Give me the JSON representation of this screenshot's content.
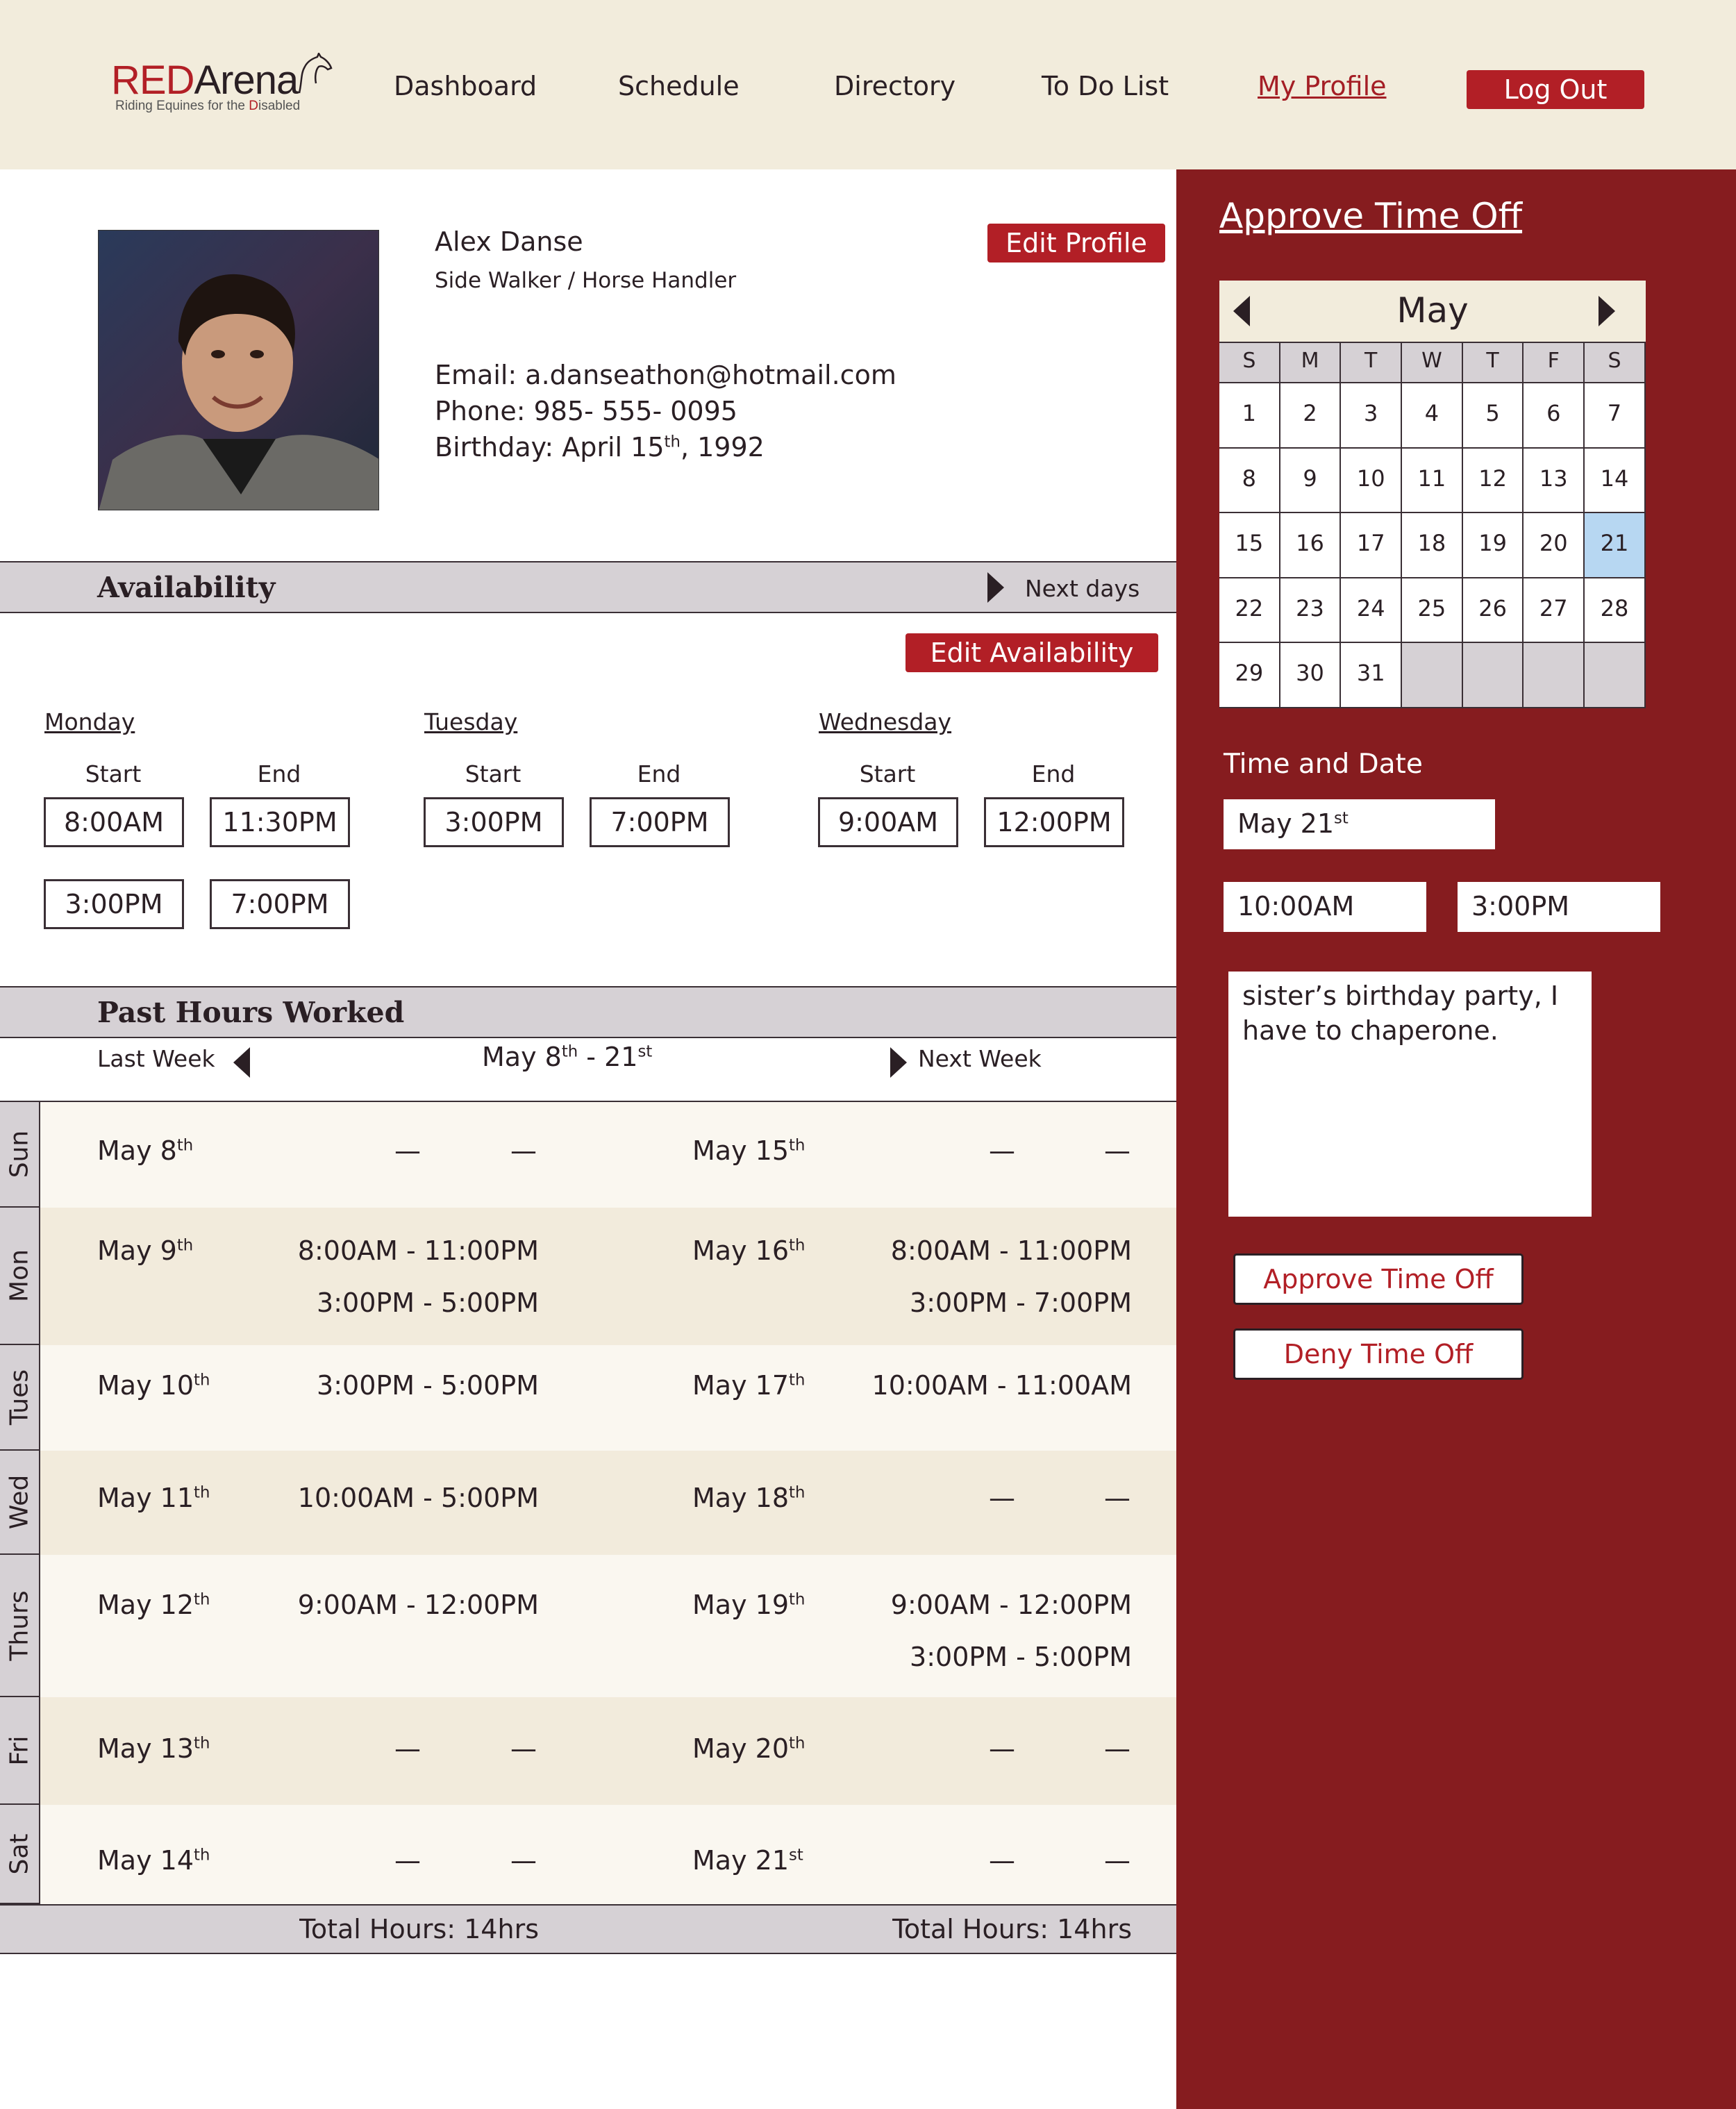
{
  "brand": {
    "red_part": "RED",
    "dark_part": "Arena",
    "tagline_prefix": "Riding Equines for the ",
    "tagline_red": "D",
    "tagline_suffix": "isabled",
    "accent_color": "#b21f26"
  },
  "nav": {
    "items": [
      "Dashboard",
      "Schedule",
      "Directory",
      "To Do List",
      "My Profile"
    ],
    "active": "My Profile",
    "logout_label": "Log Out"
  },
  "profile": {
    "name": "Alex Danse",
    "role": "Side Walker / Horse Handler",
    "email_line": "Email: a.danseathon@hotmail.com",
    "phone_line": "Phone: 985- 555- 0095",
    "birthday_prefix": "Birthday: April 15",
    "birthday_sup": "th",
    "birthday_suffix": ", 1992",
    "edit_label": "Edit Profile"
  },
  "availability": {
    "title": "Availability",
    "next_label": "Next days",
    "edit_label": "Edit Availability",
    "start_label": "Start",
    "end_label": "End",
    "days": [
      {
        "name": "Monday",
        "slots": [
          [
            "8:00AM",
            "11:30PM"
          ],
          [
            "3:00PM",
            "7:00PM"
          ]
        ]
      },
      {
        "name": "Tuesday",
        "slots": [
          [
            "3:00PM",
            "7:00PM"
          ]
        ]
      },
      {
        "name": "Wednesday",
        "slots": [
          [
            "9:00AM",
            "12:00PM"
          ]
        ]
      }
    ]
  },
  "past_hours": {
    "title": "Past Hours Worked",
    "last_week": "Last Week",
    "next_week": "Next Week",
    "range_a": "May 8",
    "range_a_sup": "th",
    "range_mid": " - 21",
    "range_b_sup": "st",
    "rows": [
      {
        "day": "Sun",
        "d1": "May 8",
        "s1": "th",
        "t1": [
          "—",
          "—"
        ],
        "d2": "May 15",
        "s2": "th",
        "t2": [
          "—",
          "—"
        ]
      },
      {
        "day": "Mon",
        "d1": "May 9",
        "s1": "th",
        "t1": [
          "8:00AM  -  11:00PM",
          "3:00PM  -  5:00PM"
        ],
        "d2": "May 16",
        "s2": "th",
        "t2": [
          "8:00AM  -  11:00PM",
          "3:00PM  -  7:00PM"
        ]
      },
      {
        "day": "Tues",
        "d1": "May 10",
        "s1": "th",
        "t1": [
          "3:00PM  -  5:00PM"
        ],
        "d2": "May 17",
        "s2": "th",
        "t2": [
          "10:00AM  -  11:00AM"
        ]
      },
      {
        "day": "Wed",
        "d1": "May 11",
        "s1": "th",
        "t1": [
          "10:00AM  -  5:00PM"
        ],
        "d2": "May 18",
        "s2": "th",
        "t2": [
          "—",
          "—"
        ]
      },
      {
        "day": "Thurs",
        "d1": "May 12",
        "s1": "th",
        "t1": [
          "9:00AM  -  12:00PM"
        ],
        "d2": "May 19",
        "s2": "th",
        "t2": [
          "9:00AM  -  12:00PM",
          "3:00PM  -  5:00PM"
        ]
      },
      {
        "day": "Fri",
        "d1": "May 13",
        "s1": "th",
        "t1": [
          "—",
          "—"
        ],
        "d2": "May 20",
        "s2": "th",
        "t2": [
          "—",
          "—"
        ]
      },
      {
        "day": "Sat",
        "d1": "May 14",
        "s1": "th",
        "t1": [
          "—",
          "—"
        ],
        "d2": "May 21",
        "s2": "st",
        "t2": [
          "—",
          "—"
        ]
      }
    ],
    "total_left": "Total Hours: 14hrs",
    "total_right": "Total Hours: 14hrs"
  },
  "time_off": {
    "title": "Approve Time Off",
    "calendar": {
      "month": "May",
      "weekdays": [
        "S",
        "M",
        "T",
        "W",
        "T",
        "F",
        "S"
      ],
      "days": [
        "1",
        "2",
        "3",
        "4",
        "5",
        "6",
        "7",
        "8",
        "9",
        "10",
        "11",
        "12",
        "13",
        "14",
        "15",
        "16",
        "17",
        "18",
        "19",
        "20",
        "21",
        "22",
        "23",
        "24",
        "25",
        "26",
        "27",
        "28",
        "29",
        "30",
        "31"
      ],
      "selected": "21",
      "selected_color": "#b7d7f2"
    },
    "time_date_label": "Time and Date",
    "date_prefix": "May 21",
    "date_sup": "st",
    "start_time": "10:00AM",
    "end_time": "3:00PM",
    "reason": "sister’s birthday party, I have to chaperone.",
    "approve_label": "Approve Time Off",
    "deny_label": "Deny Time Off",
    "panel_color": "#861c1f"
  }
}
